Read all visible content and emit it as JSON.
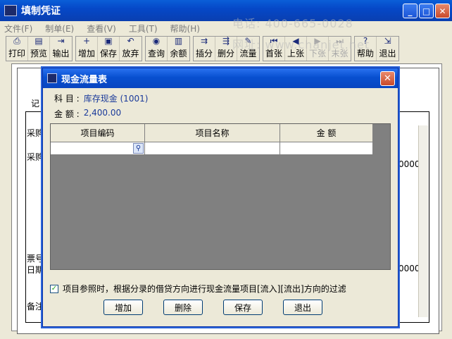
{
  "window": {
    "title": "填制凭证",
    "minimize": "_",
    "maximize": "□",
    "close": "✕"
  },
  "menu": [
    {
      "label": "文件(F)"
    },
    {
      "label": "制单(E)"
    },
    {
      "label": "查看(V)"
    },
    {
      "label": "工具(T)"
    },
    {
      "label": "帮助(H)"
    }
  ],
  "toolbar": {
    "groups": [
      [
        {
          "label": "打印",
          "icon": "printer-icon",
          "glyph": "⎙"
        },
        {
          "label": "预览",
          "icon": "preview-icon",
          "glyph": "▤"
        },
        {
          "label": "输出",
          "icon": "export-icon",
          "glyph": "⇥"
        }
      ],
      [
        {
          "label": "增加",
          "icon": "add-icon",
          "glyph": "+"
        },
        {
          "label": "保存",
          "icon": "save-icon",
          "glyph": "▣"
        },
        {
          "label": "放弃",
          "icon": "undo-icon",
          "glyph": "↶"
        }
      ],
      [
        {
          "label": "查询",
          "icon": "binoculars-icon",
          "glyph": "◉"
        },
        {
          "label": "余额",
          "icon": "bar-chart-icon",
          "glyph": "▥"
        }
      ],
      [
        {
          "label": "插分",
          "icon": "insert-row-icon",
          "glyph": "⇉"
        },
        {
          "label": "删分",
          "icon": "delete-row-icon",
          "glyph": "⇶"
        },
        {
          "label": "流量",
          "icon": "flow-icon",
          "glyph": "✎"
        }
      ],
      [
        {
          "label": "首张",
          "icon": "first-icon",
          "glyph": "⏮"
        },
        {
          "label": "上张",
          "icon": "prev-icon",
          "glyph": "◀"
        },
        {
          "label": "下张",
          "icon": "next-icon",
          "glyph": "▶",
          "disabled": true
        },
        {
          "label": "末张",
          "icon": "last-icon",
          "glyph": "⏭",
          "disabled": true
        }
      ],
      [
        {
          "label": "帮助",
          "icon": "help-icon",
          "glyph": "?"
        },
        {
          "label": "退出",
          "icon": "exit-icon",
          "glyph": "⇲"
        }
      ]
    ]
  },
  "background_doc": {
    "label_ji": "记",
    "label_cai1": "采购",
    "label_cai2": "采购",
    "label_piao": "票号",
    "label_riqi": "日期",
    "label_beizhu": "备注",
    "amount1": "0000",
    "amount2": "0000"
  },
  "watermarks": [
    "电话: 400-665-0028",
    "网址: www.chanjet.net"
  ],
  "dialog": {
    "title": "现金流量表",
    "subject_label": "科 目 :",
    "subject_value": "库存现金 (1001)",
    "amount_label": "金 额 :",
    "amount_value": "2,400.00",
    "columns": [
      "项目编码",
      "项目名称",
      "金  额"
    ],
    "checkbox_label": "项目参照时，根据分录的借贷方向进行现金流量项目[流入][流出]方向的过滤",
    "checkbox_checked": "✓",
    "buttons": {
      "add": "增加",
      "delete": "删除",
      "save": "保存",
      "exit": "退出"
    },
    "close": "✕"
  }
}
